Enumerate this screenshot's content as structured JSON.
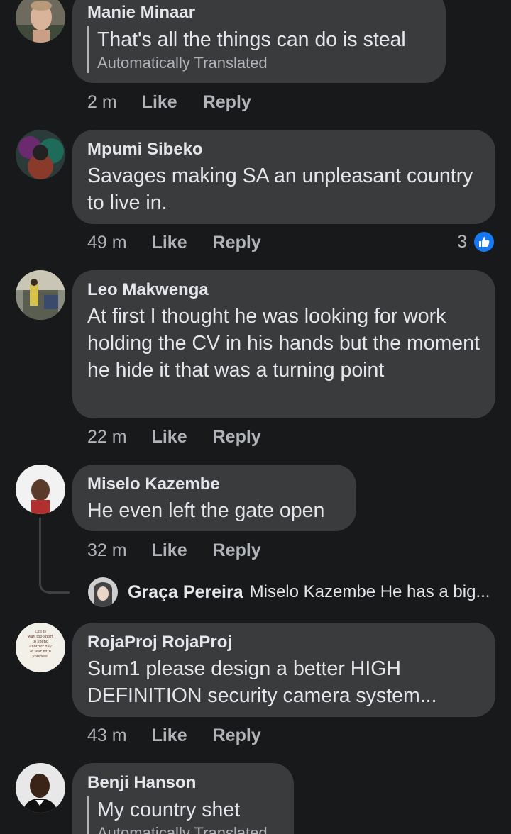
{
  "comments": [
    {
      "author": "Manie Minaar",
      "text": "That's all the things can do is steal",
      "translated_label": "Automatically Translated",
      "time": "2 m",
      "like": "Like",
      "reply": "Reply"
    },
    {
      "author": "Mpumi Sibeko",
      "text": "Savages making SA an unpleasant country to live in.",
      "time": "49 m",
      "like": "Like",
      "reply": "Reply",
      "reaction_count": "3",
      "reaction_icon": "like-icon"
    },
    {
      "author": "Leo Makwenga",
      "text": "At first I thought he was looking for work holding the CV in his hands but the moment he hide it that was a turning point",
      "time": "22 m",
      "like": "Like",
      "reply": "Reply"
    },
    {
      "author": "Miselo Kazembe",
      "text": "He even left the gate open",
      "time": "32 m",
      "like": "Like",
      "reply": "Reply",
      "reply_preview": {
        "author": "Graça Pereira",
        "snippet": "Miselo Kazembe He has a big..."
      }
    },
    {
      "author": "RojaProj RojaProj",
      "text": "Sum1 please design a better HIGH DEFINITION security camera system...",
      "time": "43 m",
      "like": "Like",
      "reply": "Reply",
      "avatar_text": "Life is way too short to spend another day at war with yourself."
    },
    {
      "author": "Benji Hanson",
      "text": "My country shet",
      "translated_label": "Automatically Translated"
    }
  ],
  "colors": {
    "background": "#18191a",
    "bubble": "#3a3b3c",
    "primary_text": "#e4e6eb",
    "secondary_text": "#b0b3b8",
    "like_blue": "#1877f2"
  }
}
